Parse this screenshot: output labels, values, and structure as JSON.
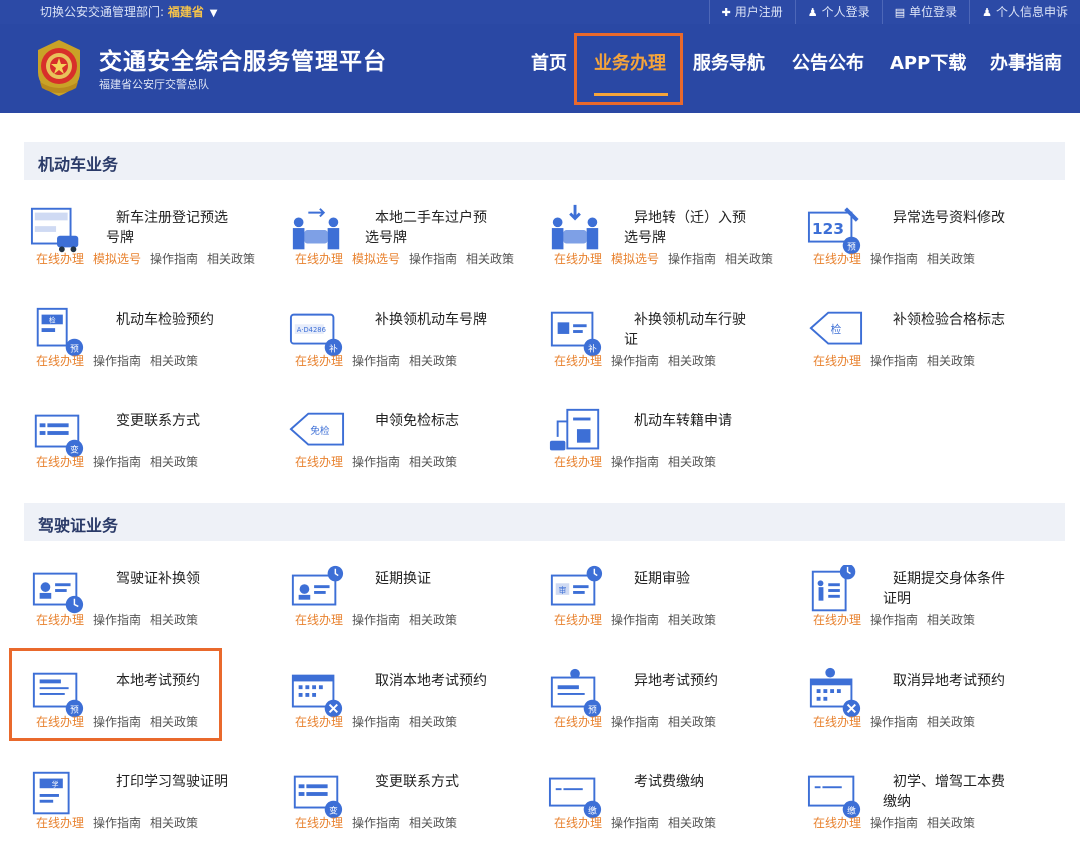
{
  "topbar": {
    "dept_label": "切换公安交通管理部门:",
    "province": "福建省",
    "links": [
      {
        "icon": "plus-icon",
        "glyph": "✚",
        "label": "用户注册"
      },
      {
        "icon": "user-icon",
        "glyph": "♟",
        "label": "个人登录"
      },
      {
        "icon": "building-icon",
        "glyph": "▤",
        "label": "单位登录"
      },
      {
        "icon": "user-icon",
        "glyph": "♟",
        "label": "个人信息申诉"
      }
    ]
  },
  "header": {
    "title": "交通安全综合服务管理平台",
    "subtitle": "福建省公安厅交警总队"
  },
  "nav": [
    {
      "label": "首页"
    },
    {
      "label": "业务办理",
      "active": true
    },
    {
      "label": "服务导航"
    },
    {
      "label": "公告公布"
    },
    {
      "label": "APP下载"
    },
    {
      "label": "办事指南"
    }
  ],
  "sections": [
    {
      "title": "机动车业务",
      "items": [
        {
          "title": "新车注册登记预选号牌",
          "icon": "new-plate-icon",
          "links": [
            "在线办理",
            "模拟选号",
            "操作指南",
            "相关政策"
          ]
        },
        {
          "title": "本地二手车过户预选号牌",
          "icon": "transfer-car-icon",
          "links": [
            "在线办理",
            "模拟选号",
            "操作指南",
            "相关政策"
          ]
        },
        {
          "title": "异地转（迁）入预选号牌",
          "icon": "migrate-car-icon",
          "links": [
            "在线办理",
            "模拟选号",
            "操作指南",
            "相关政策"
          ]
        },
        {
          "title": "异常选号资料修改",
          "icon": "edit-number-icon",
          "links": [
            "在线办理",
            "操作指南",
            "相关政策"
          ]
        },
        {
          "title": "机动车检验预约",
          "icon": "inspection-booking-icon",
          "links": [
            "在线办理",
            "操作指南",
            "相关政策"
          ]
        },
        {
          "title": "补换领机动车号牌",
          "icon": "plate-replace-icon",
          "links": [
            "在线办理",
            "操作指南",
            "相关政策"
          ]
        },
        {
          "title": "补换领机动车行驶证",
          "icon": "license-replace-icon",
          "links": [
            "在线办理",
            "操作指南",
            "相关政策"
          ]
        },
        {
          "title": "补领检验合格标志",
          "icon": "inspection-mark-icon",
          "links": [
            "在线办理",
            "操作指南",
            "相关政策"
          ]
        },
        {
          "title": "变更联系方式",
          "icon": "contact-change-icon",
          "links": [
            "在线办理",
            "操作指南",
            "相关政策"
          ]
        },
        {
          "title": "申领免检标志",
          "icon": "exempt-mark-icon",
          "links": [
            "在线办理",
            "操作指南",
            "相关政策"
          ]
        },
        {
          "title": "机动车转籍申请",
          "icon": "vehicle-transfer-icon",
          "links": [
            "在线办理",
            "操作指南",
            "相关政策"
          ]
        }
      ]
    },
    {
      "title": "驾驶证业务",
      "items": [
        {
          "title": "驾驶证补换领",
          "icon": "driver-license-icon",
          "links": [
            "在线办理",
            "操作指南",
            "相关政策"
          ]
        },
        {
          "title": "延期换证",
          "icon": "renew-delay-icon",
          "links": [
            "在线办理",
            "操作指南",
            "相关政策"
          ]
        },
        {
          "title": "延期审验",
          "icon": "audit-delay-icon",
          "links": [
            "在线办理",
            "操作指南",
            "相关政策"
          ]
        },
        {
          "title": "延期提交身体条件证明",
          "icon": "health-cert-icon",
          "links": [
            "在线办理",
            "操作指南",
            "相关政策"
          ]
        },
        {
          "title": "本地考试预约",
          "icon": "exam-booking-icon",
          "links": [
            "在线办理",
            "操作指南",
            "相关政策"
          ]
        },
        {
          "title": "取消本地考试预约",
          "icon": "cancel-exam-icon",
          "links": [
            "在线办理",
            "操作指南",
            "相关政策"
          ]
        },
        {
          "title": "异地考试预约",
          "icon": "remote-exam-icon",
          "links": [
            "在线办理",
            "操作指南",
            "相关政策"
          ]
        },
        {
          "title": "取消异地考试预约",
          "icon": "cancel-remote-exam-icon",
          "links": [
            "在线办理",
            "操作指南",
            "相关政策"
          ]
        },
        {
          "title": "打印学习驾驶证明",
          "icon": "print-learning-icon",
          "links": [
            "在线办理",
            "操作指南",
            "相关政策"
          ]
        },
        {
          "title": "变更联系方式",
          "icon": "contact-change-icon",
          "links": [
            "在线办理",
            "操作指南",
            "相关政策"
          ]
        },
        {
          "title": "考试费缴纳",
          "icon": "exam-fee-icon",
          "links": [
            "在线办理",
            "操作指南",
            "相关政策"
          ]
        },
        {
          "title": "初学、增驾工本费缴纳",
          "icon": "license-fee-icon",
          "links": [
            "在线办理",
            "操作指南",
            "相关政策"
          ]
        }
      ]
    }
  ],
  "colors": {
    "header_blue": "#2a48a4",
    "accent_orange": "#f5a43b",
    "link_orange": "#e8822f",
    "highlight_red": "#e9692c",
    "icon_blue": "#3d6fd6"
  }
}
